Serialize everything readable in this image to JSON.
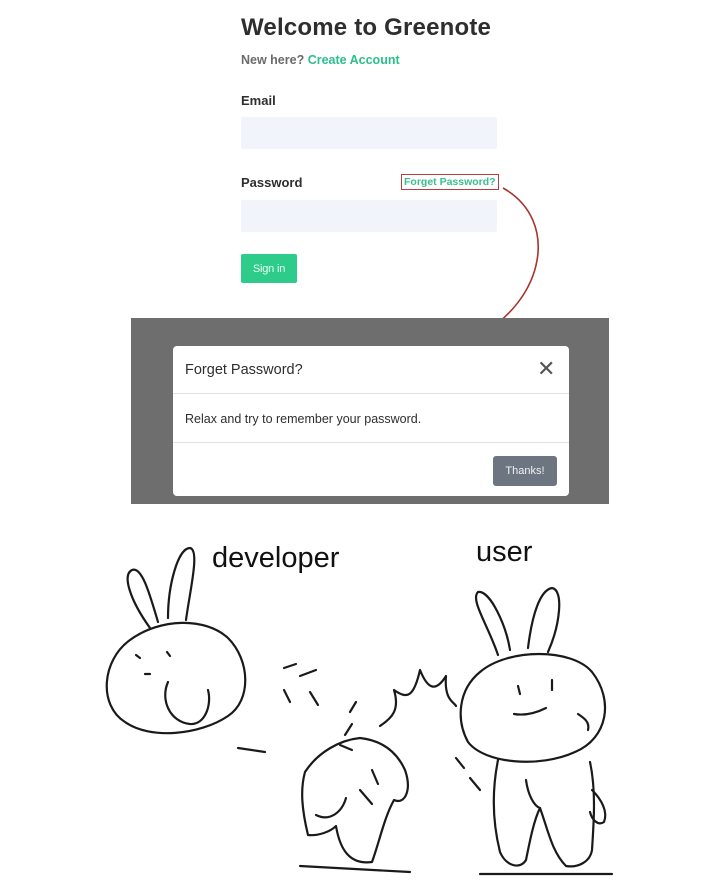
{
  "login": {
    "title": "Welcome to Greenote",
    "new_here": "New here?",
    "create_account": "Create Account",
    "email_label": "Email",
    "email_value": "",
    "password_label": "Password",
    "password_value": "",
    "forgot_password": "Forget Password?",
    "sign_in": "Sign in"
  },
  "modal": {
    "title": "Forget Password?",
    "body": "Relax and try to remember your password.",
    "close_icon": "close-icon",
    "button": "Thanks!"
  },
  "meme": {
    "developer_label": "developer",
    "user_label": "user"
  },
  "colors": {
    "accent_green": "#2ecc8a",
    "highlight_red": "#b3403c",
    "backdrop": "#6e6e6e",
    "button_gray": "#6c7580"
  }
}
